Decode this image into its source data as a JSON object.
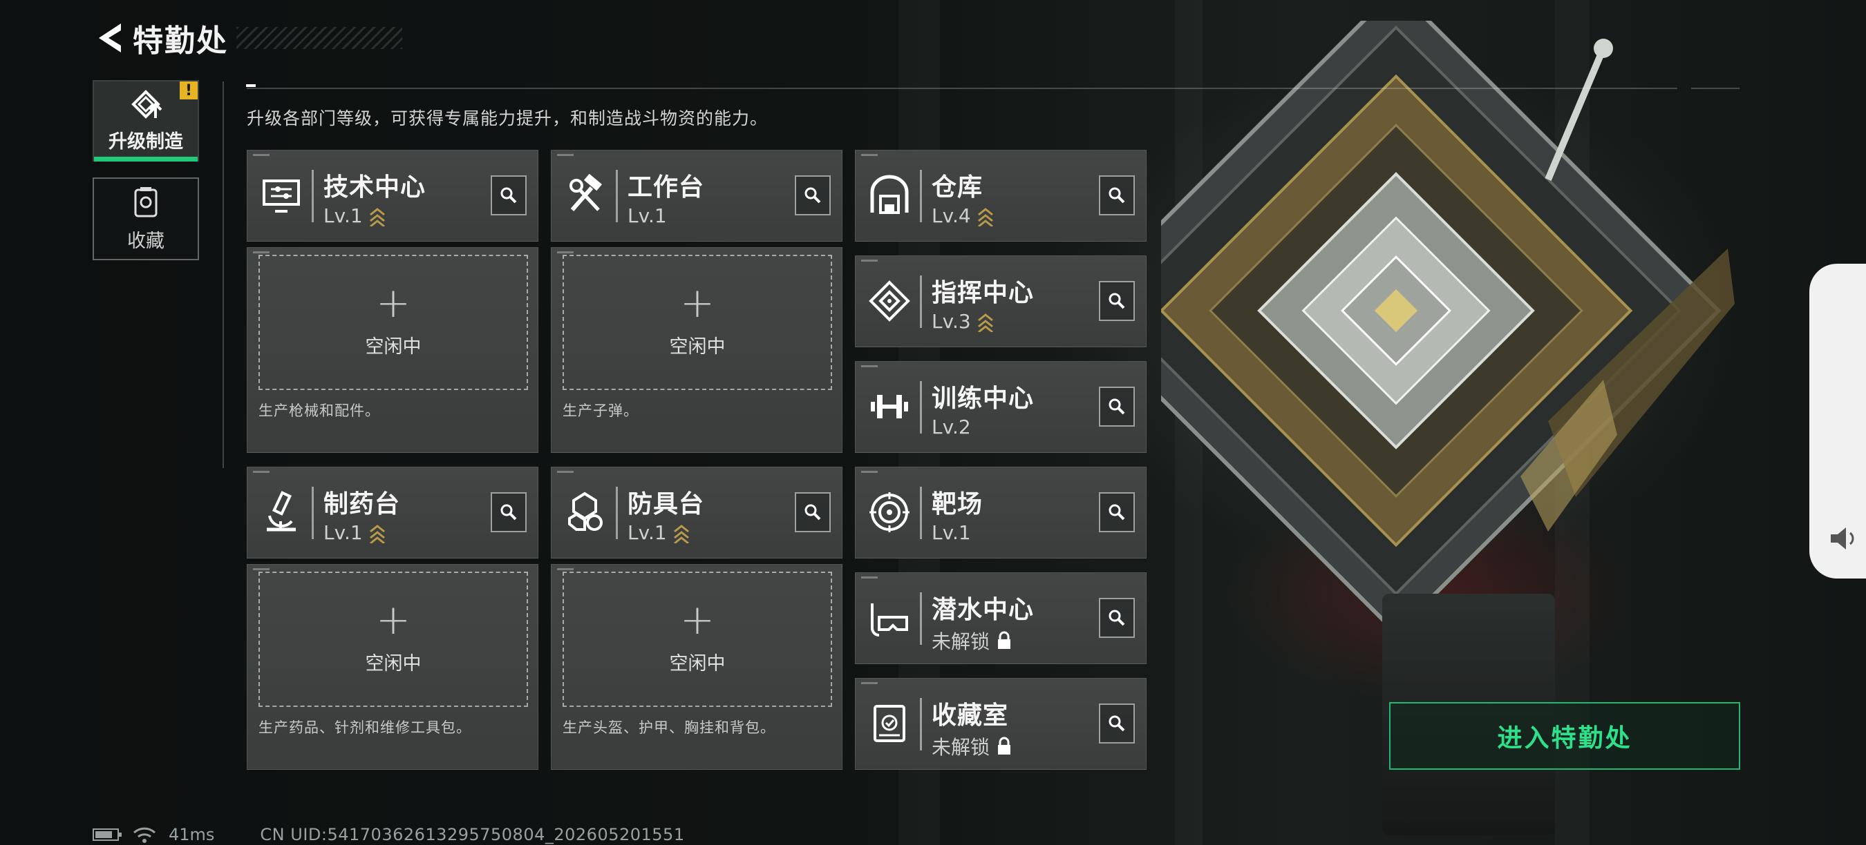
{
  "header": {
    "title": "特勤处"
  },
  "tabs": [
    {
      "label": "升级制造",
      "icon": "upgrade-icon",
      "active": true,
      "alert": "!"
    },
    {
      "label": "收藏",
      "icon": "collection-icon",
      "active": false
    }
  ],
  "description": "升级各部门等级，可获得专属能力提升，和制造战斗物资的能力。",
  "production_rooms": [
    {
      "name": "技术中心",
      "level": "Lv.1",
      "upgradable": true,
      "icon": "computer-settings-icon",
      "slot_status": "空闲中",
      "slot_desc": "生产枪械和配件。"
    },
    {
      "name": "工作台",
      "level": "Lv.1",
      "upgradable": false,
      "icon": "hammer-wrench-icon",
      "slot_status": "空闲中",
      "slot_desc": "生产子弹。"
    },
    {
      "name": "制药台",
      "level": "Lv.1",
      "upgradable": true,
      "icon": "microscope-icon",
      "slot_status": "空闲中",
      "slot_desc": "生产药品、针剂和维修工具包。"
    },
    {
      "name": "防具台",
      "level": "Lv.1",
      "upgradable": true,
      "icon": "armor-parts-icon",
      "slot_status": "空闲中",
      "slot_desc": "生产头盔、护甲、胸挂和背包。"
    }
  ],
  "facility_rooms": [
    {
      "name": "仓库",
      "level": "Lv.4",
      "upgradable": true,
      "icon": "warehouse-icon"
    },
    {
      "name": "指挥中心",
      "level": "Lv.3",
      "upgradable": true,
      "icon": "command-diamond-icon"
    },
    {
      "name": "训练中心",
      "level": "Lv.2",
      "upgradable": false,
      "icon": "dumbbell-icon"
    },
    {
      "name": "靶场",
      "level": "Lv.1",
      "upgradable": false,
      "icon": "target-icon"
    },
    {
      "name": "潜水中心",
      "level": "未解锁",
      "locked": true,
      "icon": "diving-mask-icon"
    },
    {
      "name": "收藏室",
      "level": "未解锁",
      "locked": true,
      "icon": "collection-room-icon"
    }
  ],
  "enter_button": {
    "label": "进入特勤处"
  },
  "status": {
    "ping": "41ms",
    "uid": "CN UID:54170362613295750804_202605201551"
  },
  "colors": {
    "accent": "#2ee08a",
    "upgrade_chevron": "#b89a4a",
    "alert": "#e6b422",
    "card_bg": "#404342"
  }
}
